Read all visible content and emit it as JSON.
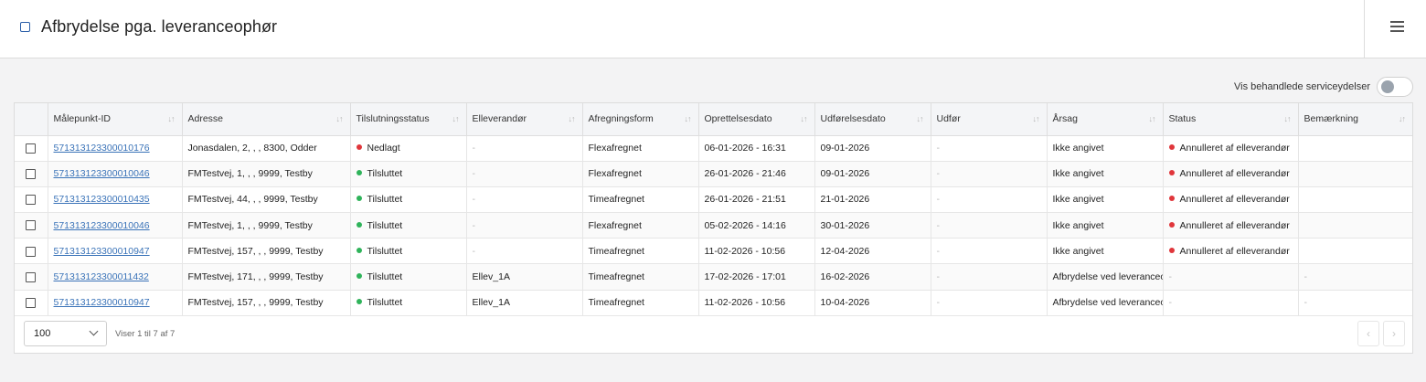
{
  "header": {
    "title": "Afbrydelse pga. leveranceophør"
  },
  "toggle": {
    "label": "Vis behandlede serviceydelser"
  },
  "colors": {
    "red_dot": "#e0363b",
    "green_dot": "#2fb35a",
    "link": "#3a73b8"
  },
  "table": {
    "columns": [
      "Målepunkt-ID",
      "Adresse",
      "Tilslutningsstatus",
      "Elleverandør",
      "Afregningsform",
      "Oprettelsesdato",
      "Udførelsesdato",
      "Udfør",
      "Årsag",
      "Status",
      "Bemærkning"
    ],
    "rows": [
      {
        "id": "571313123300010176",
        "address": "Jonasdalen, 2, , , 8300, Odder",
        "conn": "Nedlagt",
        "conn_color": "red",
        "supplier": "-",
        "billing": "Flexafregnet",
        "created": "06-01-2026 - 16:31",
        "executed": "09-01-2026",
        "perform": "-",
        "reason": "Ikke angivet",
        "status": "Annulleret af elleverandør",
        "status_dot": true,
        "remark": ""
      },
      {
        "id": "571313123300010046",
        "address": "FMTestvej, 1, , , 9999, Testby",
        "conn": "Tilsluttet",
        "conn_color": "green",
        "supplier": "-",
        "billing": "Flexafregnet",
        "created": "26-01-2026 - 21:46",
        "executed": "09-01-2026",
        "perform": "-",
        "reason": "Ikke angivet",
        "status": "Annulleret af elleverandør",
        "status_dot": true,
        "remark": ""
      },
      {
        "id": "571313123300010435",
        "address": "FMTestvej, 44, , , 9999, Testby",
        "conn": "Tilsluttet",
        "conn_color": "green",
        "supplier": "-",
        "billing": "Timeafregnet",
        "created": "26-01-2026 - 21:51",
        "executed": "21-01-2026",
        "perform": "-",
        "reason": "Ikke angivet",
        "status": "Annulleret af elleverandør",
        "status_dot": true,
        "remark": ""
      },
      {
        "id": "571313123300010046",
        "address": "FMTestvej, 1, , , 9999, Testby",
        "conn": "Tilsluttet",
        "conn_color": "green",
        "supplier": "-",
        "billing": "Flexafregnet",
        "created": "05-02-2026 - 14:16",
        "executed": "30-01-2026",
        "perform": "-",
        "reason": "Ikke angivet",
        "status": "Annulleret af elleverandør",
        "status_dot": true,
        "remark": ""
      },
      {
        "id": "571313123300010947",
        "address": "FMTestvej, 157, , , 9999, Testby",
        "conn": "Tilsluttet",
        "conn_color": "green",
        "supplier": "-",
        "billing": "Timeafregnet",
        "created": "11-02-2026 - 10:56",
        "executed": "12-04-2026",
        "perform": "-",
        "reason": "Ikke angivet",
        "status": "Annulleret af elleverandør",
        "status_dot": true,
        "remark": ""
      },
      {
        "id": "571313123300011432",
        "address": "FMTestvej, 171, , , 9999, Testby",
        "conn": "Tilsluttet",
        "conn_color": "green",
        "supplier": "Ellev_1A",
        "billing": "Timeafregnet",
        "created": "17-02-2026 - 17:01",
        "executed": "16-02-2026",
        "perform": "-",
        "reason": "Afbrydelse ved leveranceophør",
        "status": "-",
        "status_dot": false,
        "remark": "-"
      },
      {
        "id": "571313123300010947",
        "address": "FMTestvej, 157, , , 9999, Testby",
        "conn": "Tilsluttet",
        "conn_color": "green",
        "supplier": "Ellev_1A",
        "billing": "Timeafregnet",
        "created": "11-02-2026 - 10:56",
        "executed": "10-04-2026",
        "perform": "-",
        "reason": "Afbrydelse ved leveranceophør",
        "status": "-",
        "status_dot": false,
        "remark": "-"
      }
    ]
  },
  "pager": {
    "page_size": "100",
    "info": "Viser 1 til 7 af 7",
    "prev_icon": "‹",
    "next_icon": "›"
  }
}
